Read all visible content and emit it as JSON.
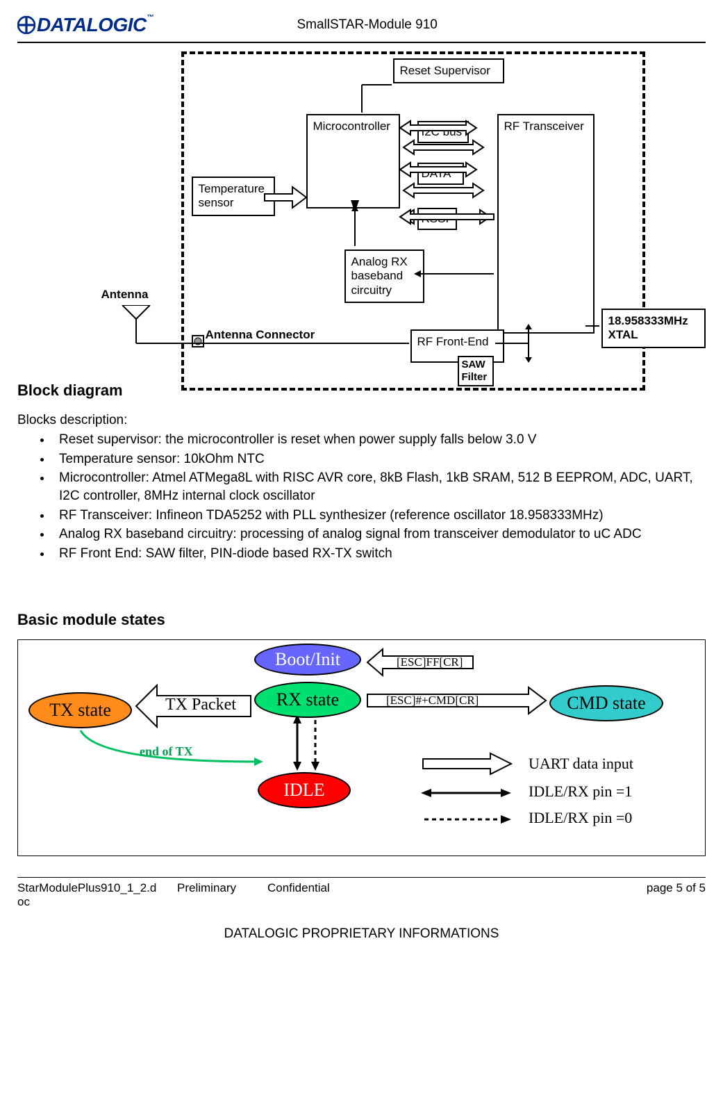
{
  "header": {
    "logo_text": "DATALOGIC",
    "logo_tm": "™",
    "title": "SmallSTAR-Module 910"
  },
  "block_diagram": {
    "heading": "Block diagram",
    "blocks": {
      "reset_supervisor": "Reset Supervisor",
      "microcontroller": "Microcontroller",
      "i2c_bus": "I2C bus",
      "rf_transceiver": "RF Transceiver",
      "data": "DATA",
      "rssi": "RSSI",
      "temperature_sensor": "Temperature\nsensor",
      "analog_rx": "Analog RX\nbaseband\ncircuitry",
      "rf_front_end": "RF Front-End",
      "saw_filter": "SAW\nFilter",
      "xtal": "18.958333MHz\nXTAL"
    },
    "labels": {
      "antenna": "Antenna",
      "antenna_connector": "Antenna Connector"
    }
  },
  "blocks_description": {
    "intro": "Blocks description:",
    "items": [
      "Reset supervisor: the microcontroller is reset when power supply falls below 3.0 V",
      "Temperature sensor: 10kOhm NTC",
      "Microcontroller: Atmel ATMega8L with RISC AVR core, 8kB Flash, 1kB SRAM, 512 B EEPROM, ADC, UART, I2C controller, 8MHz internal clock oscillator",
      "RF Transceiver: Infineon TDA5252 with PLL synthesizer (reference oscillator 18.958333MHz)",
      "Analog RX baseband circuitry: processing of analog signal from transceiver demodulator to uC ADC",
      "RF Front End: SAW filter, PIN-diode based RX-TX switch"
    ]
  },
  "states": {
    "heading": "Basic module states",
    "boot_init": "Boot/Init",
    "tx_state": "TX state",
    "tx_packet": "TX Packet",
    "rx_state": "RX state",
    "cmd_state": "CMD state",
    "idle": "IDLE",
    "end_of_tx": "end of TX",
    "esc_ff": "[ESC]FF[CR]",
    "esc_cmd": "[ESC]#+CMD[CR]",
    "legend_uart": "UART data input",
    "legend_pin1": "IDLE/RX pin =1",
    "legend_pin0": "IDLE/RX pin =0"
  },
  "footer": {
    "doc": "StarModulePlus910_1_2.d",
    "suffix": "oc",
    "status": "Preliminary",
    "conf": "Confidential",
    "page": "page 5 of 5",
    "proprietary": "DATALOGIC PROPRIETARY INFORMATIONS"
  }
}
